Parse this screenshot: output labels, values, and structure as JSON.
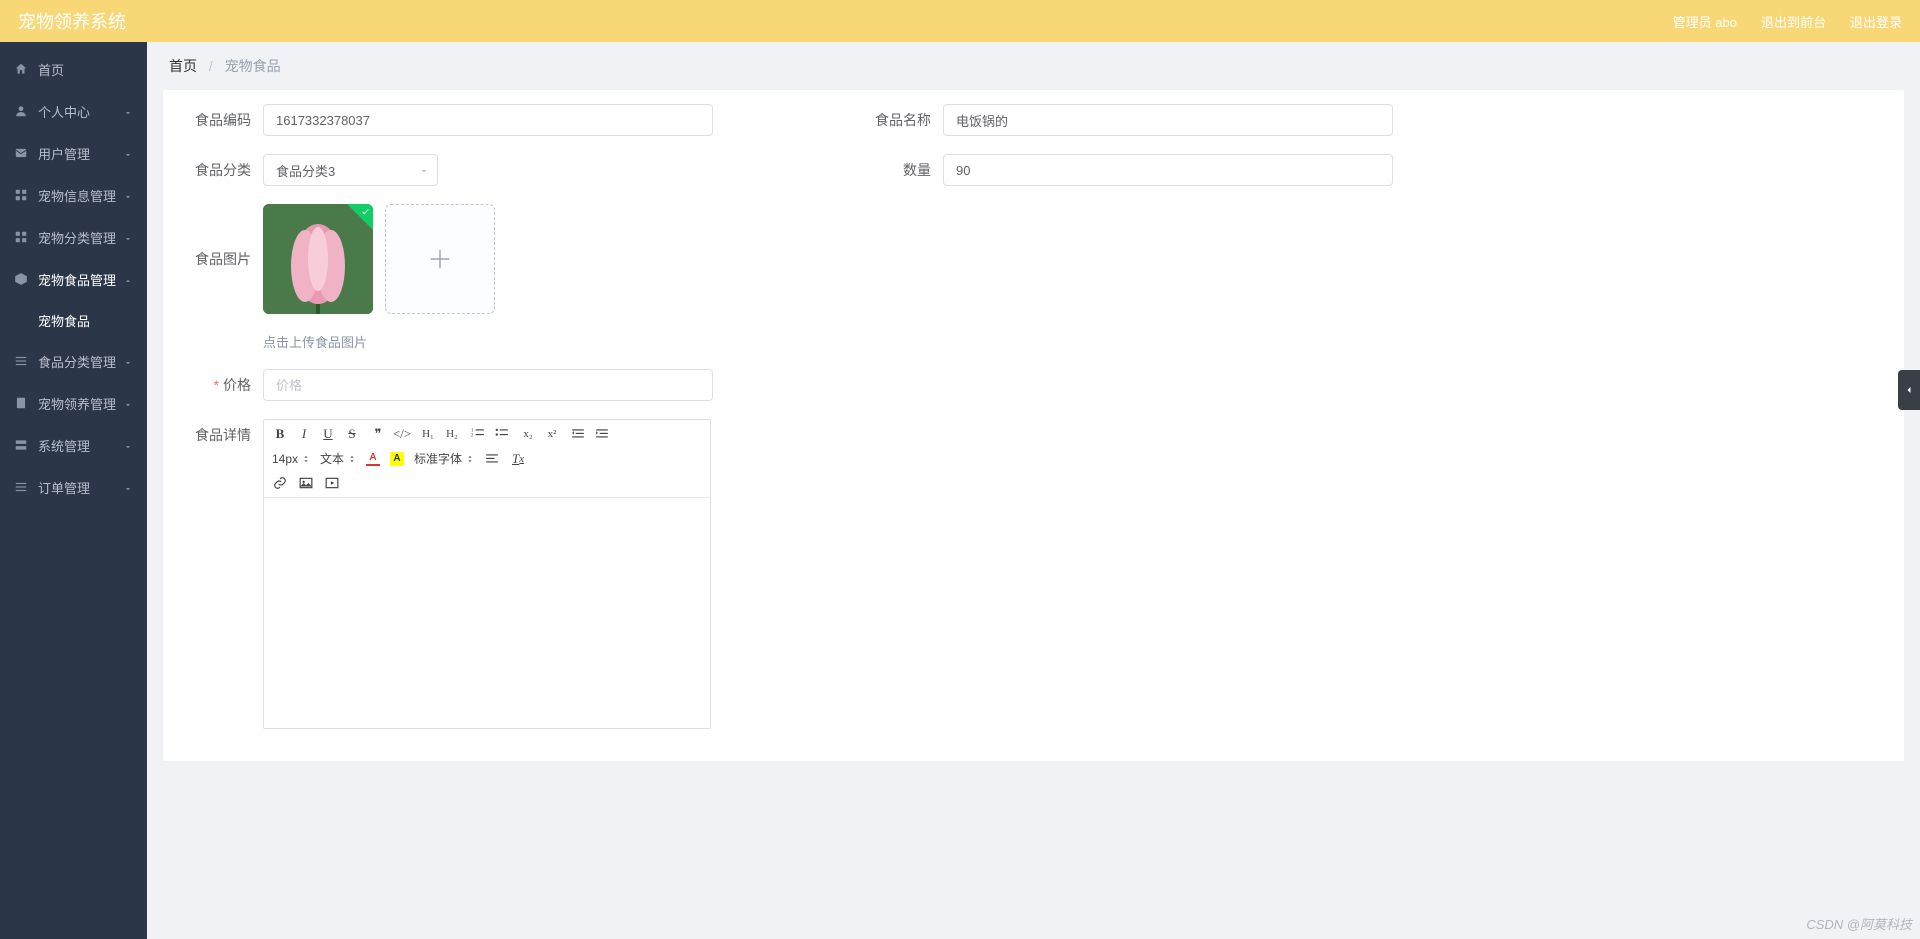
{
  "header": {
    "title": "宠物领养系统",
    "admin_label": "管理员 abo",
    "exit_front": "退出到前台",
    "logout": "退出登录"
  },
  "sidebar": {
    "items": [
      {
        "label": "首页",
        "icon": "home",
        "expandable": false
      },
      {
        "label": "个人中心",
        "icon": "user",
        "expandable": true
      },
      {
        "label": "用户管理",
        "icon": "mail",
        "expandable": true
      },
      {
        "label": "宠物信息管理",
        "icon": "grid",
        "expandable": true
      },
      {
        "label": "宠物分类管理",
        "icon": "grid",
        "expandable": true
      },
      {
        "label": "宠物食品管理",
        "icon": "box",
        "expandable": true,
        "open": true,
        "children": [
          {
            "label": "宠物食品"
          }
        ]
      },
      {
        "label": "食品分类管理",
        "icon": "list",
        "expandable": true
      },
      {
        "label": "宠物领养管理",
        "icon": "doc",
        "expandable": true
      },
      {
        "label": "系统管理",
        "icon": "server",
        "expandable": true
      },
      {
        "label": "订单管理",
        "icon": "list",
        "expandable": true
      }
    ]
  },
  "breadcrumb": {
    "home": "首页",
    "current": "宠物食品"
  },
  "form": {
    "code_label": "食品编码",
    "code_value": "1617332378037",
    "name_label": "食品名称",
    "name_value": "电饭锅的",
    "category_label": "食品分类",
    "category_value": "食品分类3",
    "qty_label": "数量",
    "qty_value": "90",
    "image_label": "食品图片",
    "upload_hint": "点击上传食品图片",
    "price_label": "价格",
    "price_placeholder": "价格",
    "detail_label": "食品详情"
  },
  "editor": {
    "fontsize": "14px",
    "block": "文本",
    "fontfam": "标准字体"
  },
  "watermark": "CSDN @阿莫科技"
}
